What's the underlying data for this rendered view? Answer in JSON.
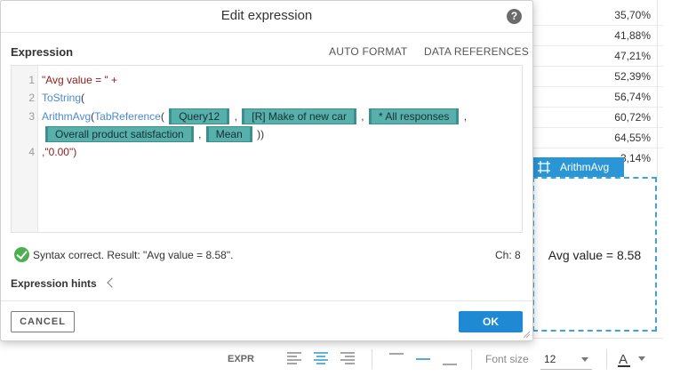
{
  "background_table": {
    "values": [
      "35,70%",
      "41,88%",
      "47,21%",
      "52,39%",
      "56,74%",
      "60,72%",
      "64,55%",
      "3,14%"
    ]
  },
  "text_box": {
    "tag_label": "ArithmAvg",
    "content": "Avg value = 8.58"
  },
  "format_toolbar": {
    "expr_label": "EXPR",
    "font_size_label": "Font size",
    "font_size_value": "12",
    "font_color_glyph": "A"
  },
  "dialog": {
    "title": "Edit expression",
    "help_glyph": "?",
    "section_label": "Expression",
    "auto_format_label": "AUTO FORMAT",
    "data_references_label": "DATA REFERENCES",
    "editor": {
      "line_numbers": [
        "1",
        "2",
        "3",
        "4"
      ],
      "line1": {
        "string": "\"Avg value = \"",
        "op": " +"
      },
      "line2": {
        "fn": "ToString",
        "paren": "("
      },
      "line3": {
        "fn1": "ArithmAvg",
        "paren1": "(",
        "fn2": "TabReference",
        "paren2": "( ",
        "chips": [
          "Query12",
          "[R] Make of new car",
          "* All responses"
        ],
        "sep": " , ",
        "trail": " ,"
      },
      "line3b": {
        "chips": [
          "Overall product satisfaction",
          "Mean"
        ],
        "sep": " , ",
        "close": " ))"
      },
      "line4": {
        "text": ",\"0.00\")"
      }
    },
    "status_text": "Syntax correct. Result: \"Avg value = 8.58\".",
    "char_count": "Ch:  8",
    "hints_label": "Expression hints",
    "cancel_label": "CANCEL",
    "ok_label": "OK"
  },
  "colors": {
    "accent": "#1f8ad3",
    "chip": "#58b0ad",
    "success": "#4caf50"
  }
}
